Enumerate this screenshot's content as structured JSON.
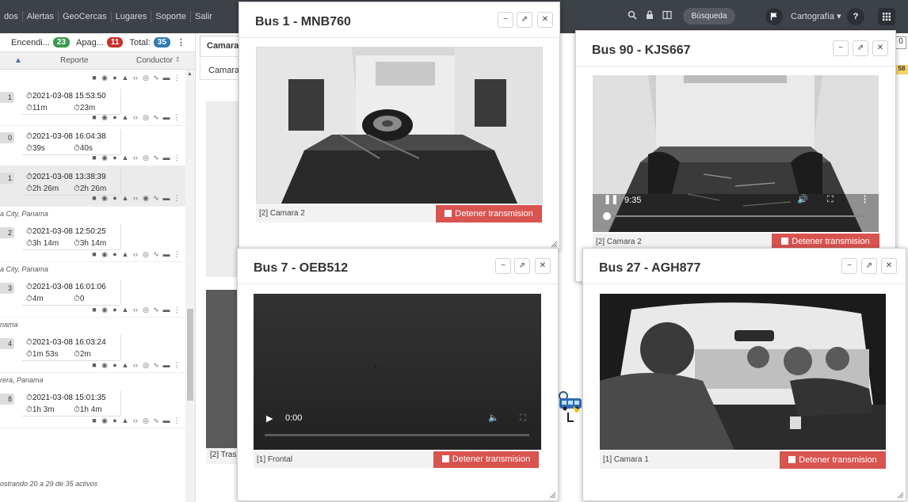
{
  "nav": {
    "links": [
      "dos",
      "Alertas",
      "GeoCercas",
      "Lugares",
      "Soporte",
      "Salir"
    ],
    "search_label": "Búsqueda",
    "carto_label": "Cartografía ▾",
    "help_label": "?"
  },
  "summary": {
    "on_label": "Encendi...",
    "on_count": "23",
    "off_label": "Apag...",
    "off_count": "11",
    "total_label": "Total:",
    "total_count": "35",
    "colors": {
      "on": "#3c9a4f",
      "off": "#c9302c",
      "total": "#337ab7"
    }
  },
  "columns": {
    "report": "Reporte",
    "driver": "Conductor"
  },
  "rows": [
    {
      "num": "1",
      "datetime": "2021-03-08 15:53:50",
      "d1": "11m",
      "d2": "23m",
      "location": ""
    },
    {
      "num": "0",
      "datetime": "2021-03-08 16:04:38",
      "d1": "39s",
      "d2": "40s",
      "location": ""
    },
    {
      "num": "1",
      "datetime": "2021-03-08 13:38:39",
      "d1": "2h 26m",
      "d2": "2h 26m",
      "location": ""
    },
    {
      "num": "2",
      "datetime": "2021-03-08 12:50:25",
      "d1": "3h 14m",
      "d2": "3h 14m",
      "location": "a City, Panama"
    },
    {
      "num": "3",
      "datetime": "2021-03-08 16:01:06",
      "d1": "4m",
      "d2": "0",
      "location": "a City, Panama"
    },
    {
      "num": "4",
      "datetime": "2021-03-08 16:03:24",
      "d1": "1m 53s",
      "d2": "2m",
      "location": "nama"
    },
    {
      "num": "8",
      "datetime": "2021-03-08 15:01:35",
      "d1": "1h 3m",
      "d2": "1h 4m",
      "location": "rera, Panama"
    }
  ],
  "footer": "ostrando 20 a 29 de 35 activos",
  "background": {
    "tab": "Camara",
    "subtab": "Camara",
    "caption": "[2] Tras",
    "right_btn": "0",
    "right_badge": "58"
  },
  "windows": [
    {
      "title": "Bus 1 - MNB760",
      "caption": "[2] Camara 2",
      "stop": "Detener transmision"
    },
    {
      "title": "Bus 90 - KJS667",
      "caption": "[2] Camara 2",
      "stop": "Detener transmision",
      "time": "9:35"
    },
    {
      "title": "Bus 7 - OEB512",
      "caption": "[1] Frontal",
      "stop": "Detener transmision",
      "time": "0:00"
    },
    {
      "title": "Bus 27 - AGH877",
      "caption": "[1] Camara 1",
      "stop": "Detener transmision"
    }
  ]
}
